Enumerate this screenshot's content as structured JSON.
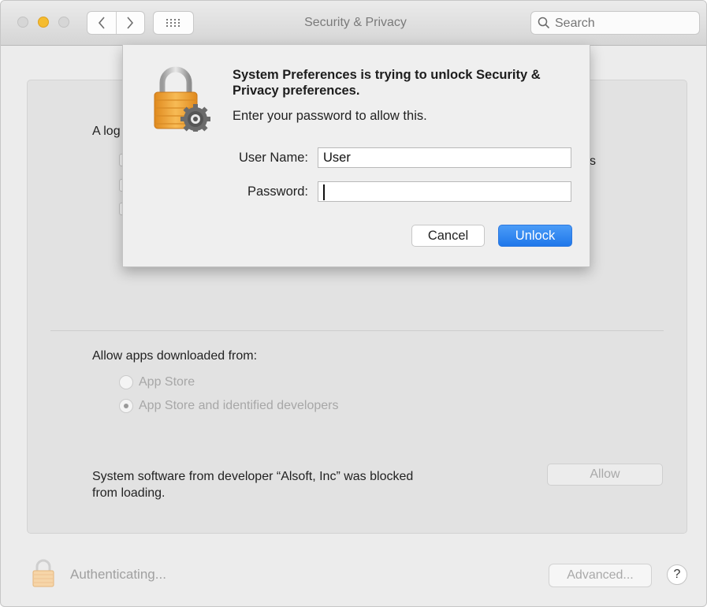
{
  "window": {
    "title": "Security & Privacy"
  },
  "toolbar": {
    "search_placeholder": "Search"
  },
  "panel": {
    "login_text_peek": "A log",
    "right_peek": "s",
    "allow_heading": "Allow apps downloaded from:",
    "radio_options": [
      {
        "label": "App Store",
        "checked": false
      },
      {
        "label": "App Store and identified developers",
        "checked": true
      }
    ],
    "blocked_message_line1": "System software from developer “Alsoft, Inc” was blocked",
    "blocked_message_line2": "from loading.",
    "allow_button": "Allow"
  },
  "footer": {
    "status": "Authenticating...",
    "advanced_button": "Advanced...",
    "help_button": "?"
  },
  "dialog": {
    "title": "System Preferences is trying to unlock Security & Privacy preferences.",
    "subtitle": "Enter your password to allow this.",
    "username_label": "User Name:",
    "username_value": "User",
    "password_label": "Password:",
    "password_value": "",
    "cancel_button": "Cancel",
    "unlock_button": "Unlock"
  },
  "icons": {
    "dialog_icon": "lock-gear-icon",
    "footer_icon": "lock-icon"
  },
  "colors": {
    "accent": "#1f77ea",
    "lock_gold": "#f0a43c",
    "minimize": "#f5bc30"
  }
}
